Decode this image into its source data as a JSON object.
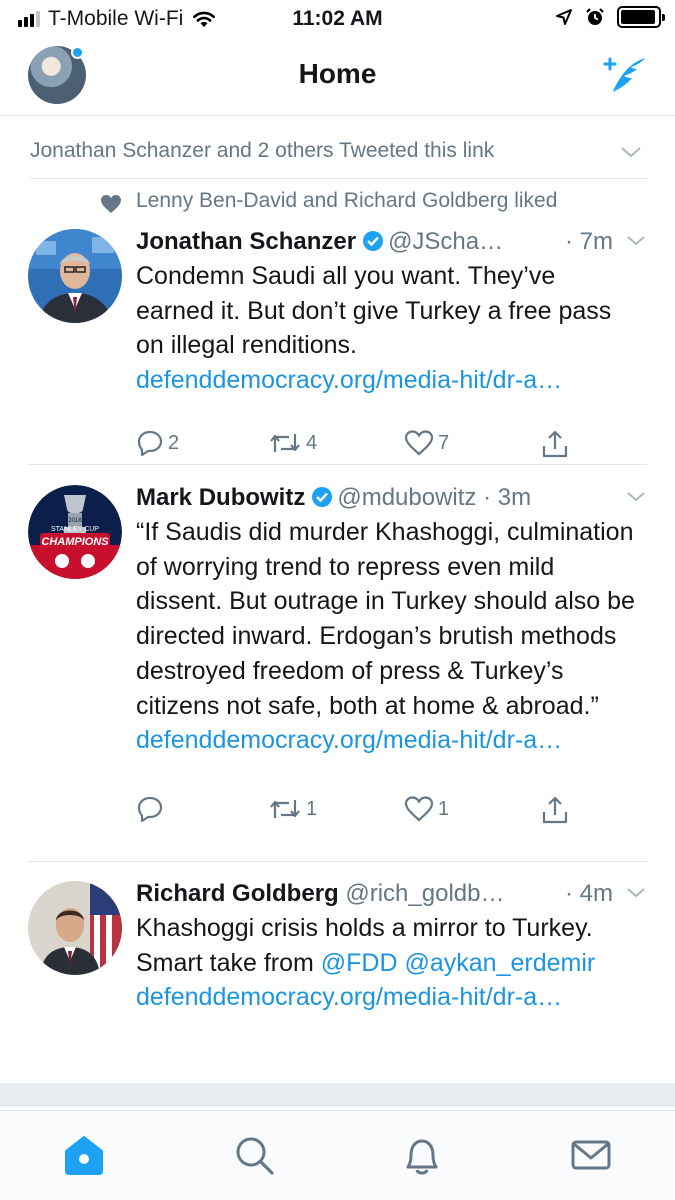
{
  "status_bar": {
    "carrier": "T-Mobile Wi-Fi",
    "time": "11:02 AM",
    "signal_bars_filled": 3,
    "signal_bars_total": 4,
    "battery_level": 0.95
  },
  "nav": {
    "title": "Home",
    "compose_icon": "compose-feather-icon",
    "profile_icon": "avatar"
  },
  "feed": {
    "conversation_header": "Jonathan Schanzer and 2 others Tweeted this link",
    "social_context": "Lenny Ben-David and Richard Goldberg liked",
    "tweets": [
      {
        "name": "Jonathan Schanzer",
        "verified": true,
        "handle": "@JScha…",
        "time": "· 7m",
        "text": "Condemn Saudi all you want. They’ve earned it. But don’t give Turkey a free pass on illegal renditions.",
        "link": "defenddemocracy.org/media-hit/dr-a…",
        "replies": "2",
        "retweets": "4",
        "likes": "7"
      },
      {
        "name": "Mark Dubowitz",
        "verified": true,
        "handle": "@mdubowitz",
        "time": "· 3m",
        "text": "“If Saudis did murder Khashoggi, culmination of worrying trend to repress even mild dissent. But outrage in Turkey should also be directed inward. Erdogan’s brutish methods destroyed freedom of press & Turkey’s citizens not safe, both at home & abroad.”",
        "link": "defenddemocracy.org/media-hit/dr-a…",
        "replies": "",
        "retweets": "1",
        "likes": "1",
        "avatar_text_1": "STANLEY CUP",
        "avatar_text_2": "CHAMPIONS",
        "avatar_text_3": "2018"
      },
      {
        "name": "Richard Goldberg",
        "verified": false,
        "handle": "@rich_goldb…",
        "time": "· 4m",
        "text_1": "Khashoggi crisis holds a mirror to Turkey. Smart take from ",
        "mention_1": "@FDD",
        "mention_2": "@aykan_erdemir",
        "link": "defenddemocracy.org/media-hit/dr-a…",
        "replies": "",
        "retweets": "",
        "likes": ""
      }
    ]
  },
  "tabbar": {
    "tabs": [
      "home-icon",
      "search-icon",
      "notifications-icon",
      "messages-icon"
    ],
    "active": "home-icon"
  },
  "colors": {
    "accent": "#1da1f2",
    "link": "#1b95e0",
    "secondary_text": "#657786",
    "divider": "#e1e8ed"
  }
}
